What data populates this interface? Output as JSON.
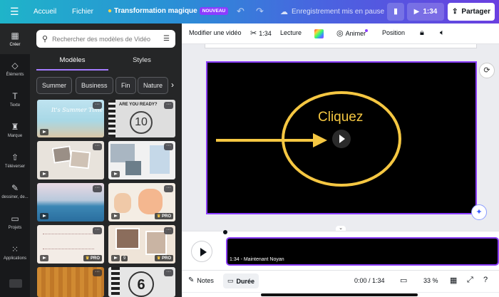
{
  "topbar": {
    "home": "Accueil",
    "file": "Fichier",
    "magic": "Transformation magique",
    "magic_badge": "NOUVEAU",
    "save_status": "Enregistrement mis en pause",
    "present_time": "1:34",
    "share": "Partager"
  },
  "rail": {
    "items": [
      "Créer",
      "Éléments",
      "Texte",
      "Marque",
      "Téléverser",
      "dessiner, de...",
      "Projets",
      "Applications"
    ]
  },
  "panel": {
    "search_placeholder": "Rechercher des modèles de Vidéo",
    "tabs": [
      "Modèles",
      "Styles"
    ],
    "chips": [
      "Summer",
      "Business",
      "Fin",
      "Nature"
    ],
    "thumb_texts": {
      "summer": "It's Summer Time",
      "ready": "ARE YOU READY?",
      "countdown": "10",
      "countdown2": "6",
      "pro": "PRO",
      "more": "···",
      "count_badge": "9"
    }
  },
  "toolbar": {
    "edit_video": "Modifier une vidéo",
    "duration": "1:34",
    "playback": "Lecture",
    "animate": "Animer",
    "position": "Position"
  },
  "canvas": {
    "text": "Cliquez"
  },
  "timeline": {
    "clip_label": "1:34 - Maintenant Noyan"
  },
  "bottombar": {
    "notes": "Notes",
    "duration": "Durée",
    "time": "0:00 / 1:34",
    "zoom": "33 %"
  },
  "colors": {
    "accent": "#8b3dff",
    "yellow": "#f5c742"
  }
}
